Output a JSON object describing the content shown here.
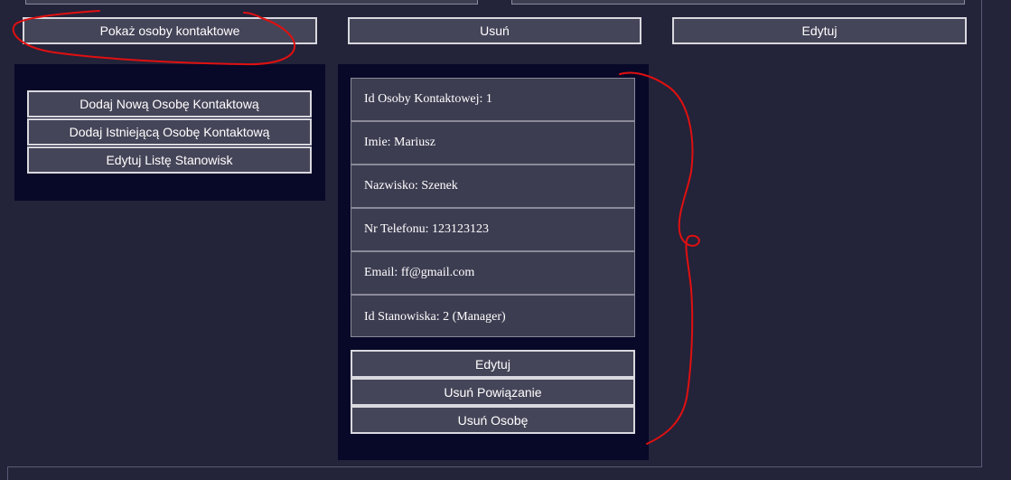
{
  "toolbar": {
    "show_contacts": "Pokaż osoby kontaktowe",
    "delete": "Usuń",
    "edit": "Edytuj"
  },
  "left_panel": {
    "add_new_contact": "Dodaj Nową Osobę Kontaktową",
    "add_existing_contact": "Dodaj Istniejącą Osobę Kontaktową",
    "edit_positions": "Edytuj Listę Stanowisk"
  },
  "contact": {
    "fields": [
      {
        "label": "Id Osoby Kontaktowej: 1"
      },
      {
        "label": "Imie: Mariusz"
      },
      {
        "label": "Nazwisko: Szenek"
      },
      {
        "label": "Nr Telefonu: 123123123"
      },
      {
        "label": "Email: ff@gmail.com"
      },
      {
        "label": "Id Stanowiska: 2 (Manager)"
      }
    ],
    "actions": {
      "edit": "Edytuj",
      "remove_link": "Usuń Powiązanie",
      "delete_person": "Usuń Osobę"
    }
  },
  "colors": {
    "background": "#23233a",
    "panel": "#080828",
    "button": "#454559",
    "button_border": "#d8d8de",
    "annotation": "#e01010"
  }
}
